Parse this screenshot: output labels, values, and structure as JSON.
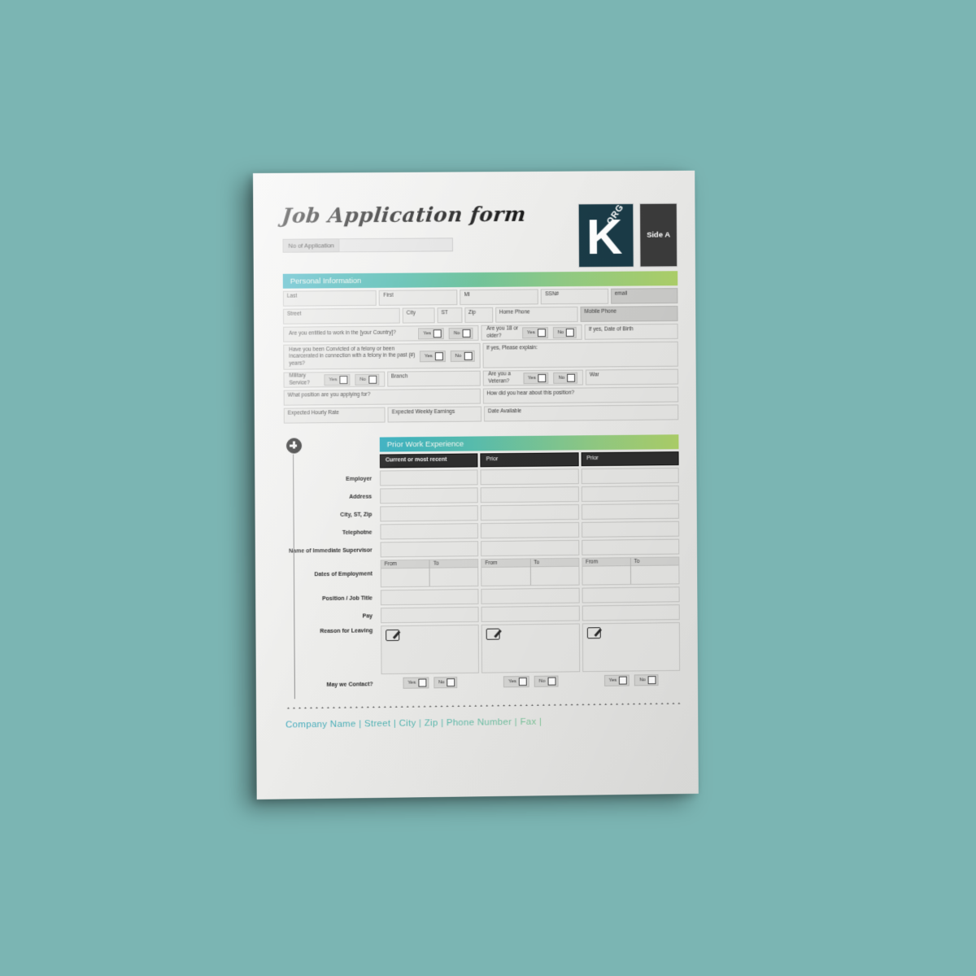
{
  "document": {
    "title": "Job Application form",
    "side_badge": "Side A",
    "logo_letter": "K",
    "logo_suffix": ".ORG",
    "no_of_application_label": "No of Application",
    "no_of_application_value": ""
  },
  "personal": {
    "section_title": "Personal Information",
    "name_fields": [
      "Last",
      "First",
      "MI",
      "SSN#",
      "email"
    ],
    "address_fields": [
      "Street",
      "City",
      "ST",
      "Zip",
      "Home Phone",
      "Mobile Phone"
    ],
    "q_work": "Are you entitled to work in the [your Country]?",
    "q_18": "Are you 18 or older?",
    "dob_label": "If yes, Date of Birth",
    "q_felony": "Have you been Convicted of a felony or been incarcerated in connection with a felony in the past (#) years?",
    "explain_label": "If yes, Please explain:",
    "q_military": "Military Service?",
    "branch_label": "Branch",
    "q_veteran": "Are you a Veteran?",
    "war_label": "War",
    "q_position": "What position are you applying for?",
    "q_hear": "How did you hear about this position?",
    "expected_hourly": "Expected Hourly Rate",
    "expected_weekly": "Expected Weekly Earnings",
    "date_available": "Date Available",
    "yes": "Yes",
    "no": "No"
  },
  "work": {
    "section_title": "Prior Work Experience",
    "columns": [
      "Current or most recent",
      "Prior",
      "Prior"
    ],
    "rows": [
      "Employer",
      "Address",
      "City, ST, Zip",
      "Telephotne",
      "Name of Immediate Supervisor",
      "Dates of Employment",
      "Position / Job Title",
      "Pay",
      "Reason for Leaving"
    ],
    "date_from": "From",
    "date_to": "To",
    "contact_label": "May we Contact?",
    "yes": "Yes",
    "no": "No"
  },
  "footer": {
    "text": "Company Name  |  Street  |  City  |  Zip  |  Phone Number  |  Fax  |"
  },
  "colors": {
    "background": "#7bb5b3",
    "logo": "#1a3b47",
    "badge": "#3b3b3b",
    "gradient_start": "#3aafc0",
    "gradient_end": "#aed169",
    "table_header": "#2e2e2e"
  }
}
